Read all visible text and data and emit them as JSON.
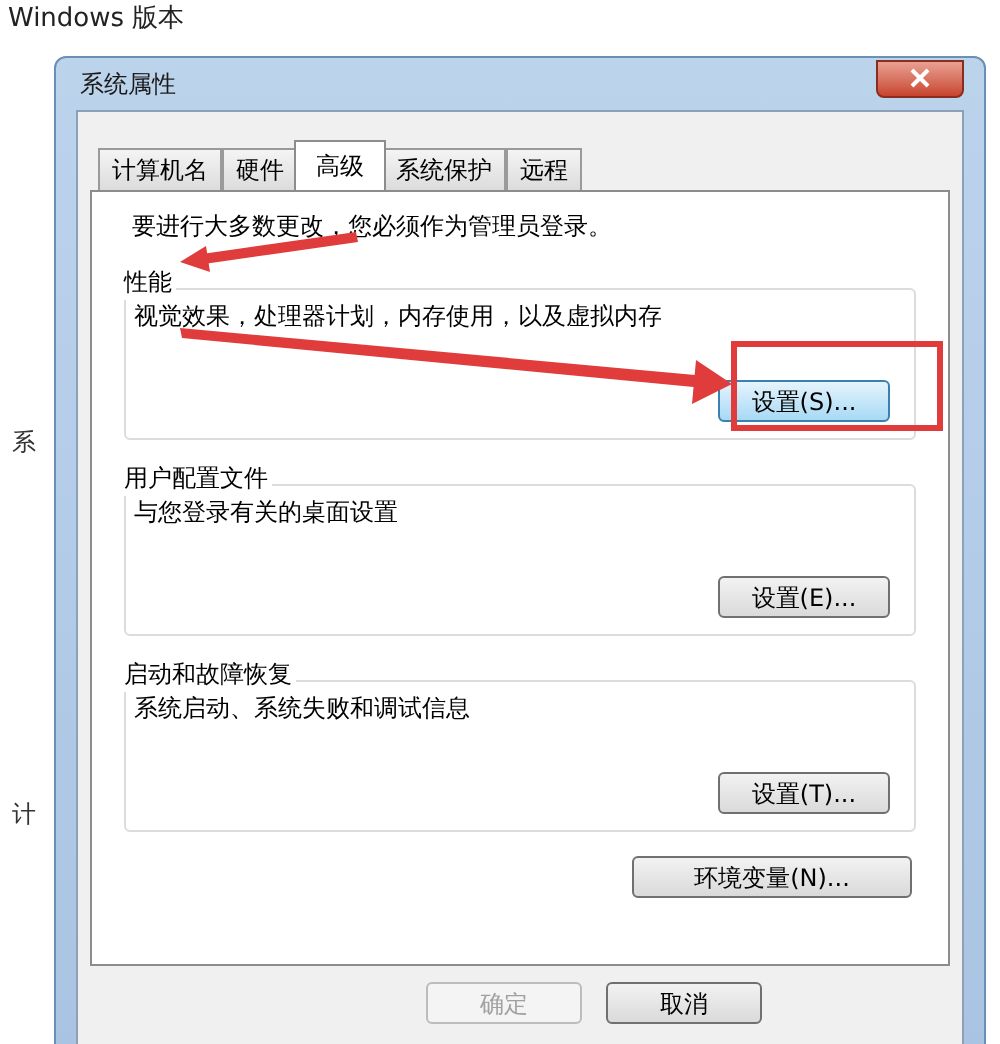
{
  "background": {
    "heading": "Windows 版本",
    "labels": [
      "系",
      "计"
    ]
  },
  "dialog": {
    "title": "系统属性",
    "tabs": [
      {
        "label": "计算机名",
        "selected": false
      },
      {
        "label": "硬件",
        "selected": false
      },
      {
        "label": "高级",
        "selected": true
      },
      {
        "label": "系统保护",
        "selected": false
      },
      {
        "label": "远程",
        "selected": false
      }
    ],
    "notice": "要进行大多数更改，您必须作为管理员登录。",
    "groups": [
      {
        "title": "性能",
        "description": "视觉效果，处理器计划，内存使用，以及虚拟内存",
        "button": "设置(S)...",
        "focused": true
      },
      {
        "title": "用户配置文件",
        "description": "与您登录有关的桌面设置",
        "button": "设置(E)...",
        "focused": false
      },
      {
        "title": "启动和故障恢复",
        "description": "系统启动、系统失败和调试信息",
        "button": "设置(T)...",
        "focused": false
      }
    ],
    "env_button": "环境变量(N)...",
    "footer_buttons": [
      {
        "label": "确定",
        "disabled": true
      },
      {
        "label": "取消",
        "disabled": false
      }
    ]
  }
}
